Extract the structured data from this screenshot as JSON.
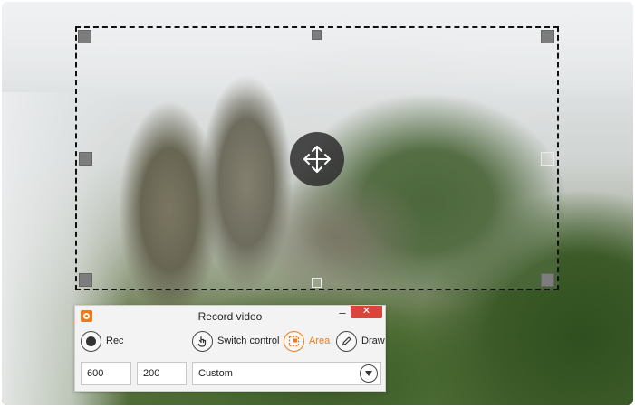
{
  "dialog": {
    "title": "Record video",
    "minimize_label": "–",
    "close_label": "✕",
    "accent_color": "#f07a1a",
    "tools": {
      "rec_label": "Rec",
      "switch_label": "Switch control",
      "area_label": "Area",
      "draw_label": "Draw"
    },
    "width_value": "600",
    "height_value": "200",
    "preset_value": "Custom"
  },
  "icons": {
    "move": "move-arrows-icon",
    "app": "app-logo-icon",
    "rec": "record-dot-icon",
    "switch": "hand-pointer-icon",
    "area": "area-select-icon",
    "draw": "pencil-icon",
    "dropdown": "chevron-down-icon"
  }
}
